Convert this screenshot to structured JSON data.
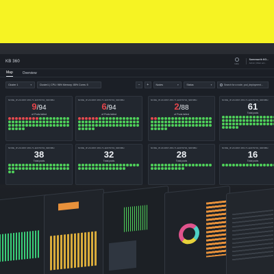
{
  "app": {
    "title": "KB 360",
    "help_label": "Help",
    "user_name": "Somnworth KG...",
    "user_role": "Admin | Main acc..."
  },
  "tabs": [
    {
      "label": "Map",
      "active": true
    },
    {
      "label": "Overview",
      "active": false
    }
  ],
  "filters": {
    "cluster_select": "Cluster 1",
    "cluster_info": "Cluster1 | CPU: 96% Memory: 85% Cores: 5",
    "minus": "−",
    "plus": "+",
    "type_select": "Nodes",
    "status_select": "Status",
    "search_placeholder": "Search for a node, pod_deployment..."
  },
  "cards": [
    {
      "node": "NODE_IP-23-0067-456-71-E3479734_SDF9BH",
      "failed": "9",
      "total": "/94",
      "sub": "of Pods failed",
      "red": 9,
      "dots": 59
    },
    {
      "node": "NODE_IP-23-0067-456-71-E3479734_SDF9BH",
      "failed": "6",
      "total": "/94",
      "sub": "of Pods failed",
      "red": 6,
      "dots": 59
    },
    {
      "node": "NODE_IP-23-0067-456-71-E3479734_SDF9BH",
      "failed": "2",
      "total": "/88",
      "sub": "of Pods failed",
      "red": 2,
      "dots": 59
    },
    {
      "node": "NODE_IP-23-0067-456-71-E3479734_SDF9BH",
      "value": "61",
      "sub": "Total pods",
      "red": 0,
      "dots": 59
    },
    {
      "node": "NODE_IP-23-0067-456-71-E3479734_SDF9BH",
      "value": "38",
      "sub": "Total pods",
      "red": 0,
      "dots": 38
    },
    {
      "node": "NODE_IP-23-0067-456-71-E3479734_SDF9BH",
      "value": "32",
      "sub": "Total pods",
      "red": 0,
      "dots": 32
    },
    {
      "node": "NODE_IP-23-0067-456-71-E3479734_SDF9BH",
      "value": "28",
      "sub": "Total pods",
      "red": 0,
      "dots": 28
    },
    {
      "node": "NODE_IP-23-0067-456-71-E3479734_SDF9BH",
      "value": "16",
      "sub": "Total pods",
      "red": 0,
      "dots": 16
    }
  ],
  "colors": {
    "yellow": "#f6f323",
    "ok": "#4fd15a",
    "fail": "#e44b4f"
  }
}
